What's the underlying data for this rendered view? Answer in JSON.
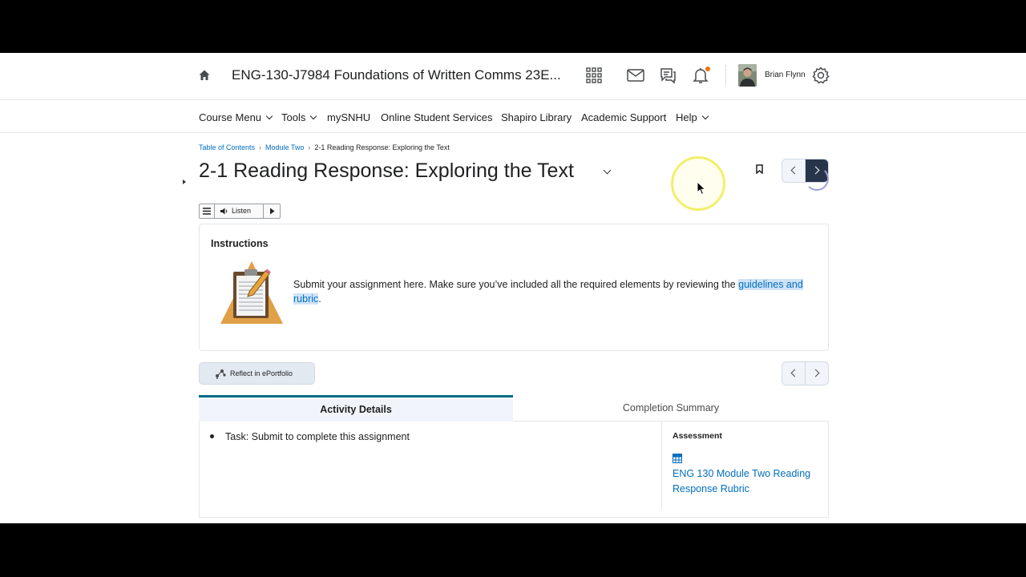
{
  "header": {
    "course_title": "ENG-130-J7984 Foundations of Written Comms 23E...",
    "user_name": "Brian Flynn",
    "icons": [
      "home-icon",
      "app-grid-icon",
      "mail-icon",
      "chat-icon",
      "bell-icon",
      "gear-icon"
    ],
    "notification_color": "#e87511"
  },
  "nav": {
    "items": [
      {
        "label": "Course Menu",
        "dropdown": true
      },
      {
        "label": "Tools",
        "dropdown": true
      },
      {
        "label": "mySNHU",
        "dropdown": false
      },
      {
        "label": "Online Student Services",
        "dropdown": false
      },
      {
        "label": "Shapiro Library",
        "dropdown": false
      },
      {
        "label": "Academic Support",
        "dropdown": false
      },
      {
        "label": "Help",
        "dropdown": true
      }
    ]
  },
  "breadcrumb": {
    "items": [
      "Table of Contents",
      "Module Two"
    ],
    "current": "2-1 Reading Response: Exploring the Text"
  },
  "page": {
    "title": "2-1 Reading Response: Exploring the Text"
  },
  "listen": {
    "label": "Listen"
  },
  "instructions": {
    "heading": "Instructions",
    "text": "Submit your assignment here. Make sure you’ve included all the required elements by reviewing the ",
    "link_text": "guidelines and rubric",
    "text_end": "."
  },
  "reflect": {
    "label": "Reflect in ePortfolio"
  },
  "tabs": {
    "active": "Activity Details",
    "inactive": "Completion Summary"
  },
  "details": {
    "task": "Task: Submit to complete this assignment",
    "assessment_heading": "Assessment",
    "rubric_link": "ENG 130 Module Two Reading Response Rubric"
  },
  "colors": {
    "link": "#006fbf",
    "tab_accent": "#006c85",
    "nav_active": "#27354a"
  }
}
